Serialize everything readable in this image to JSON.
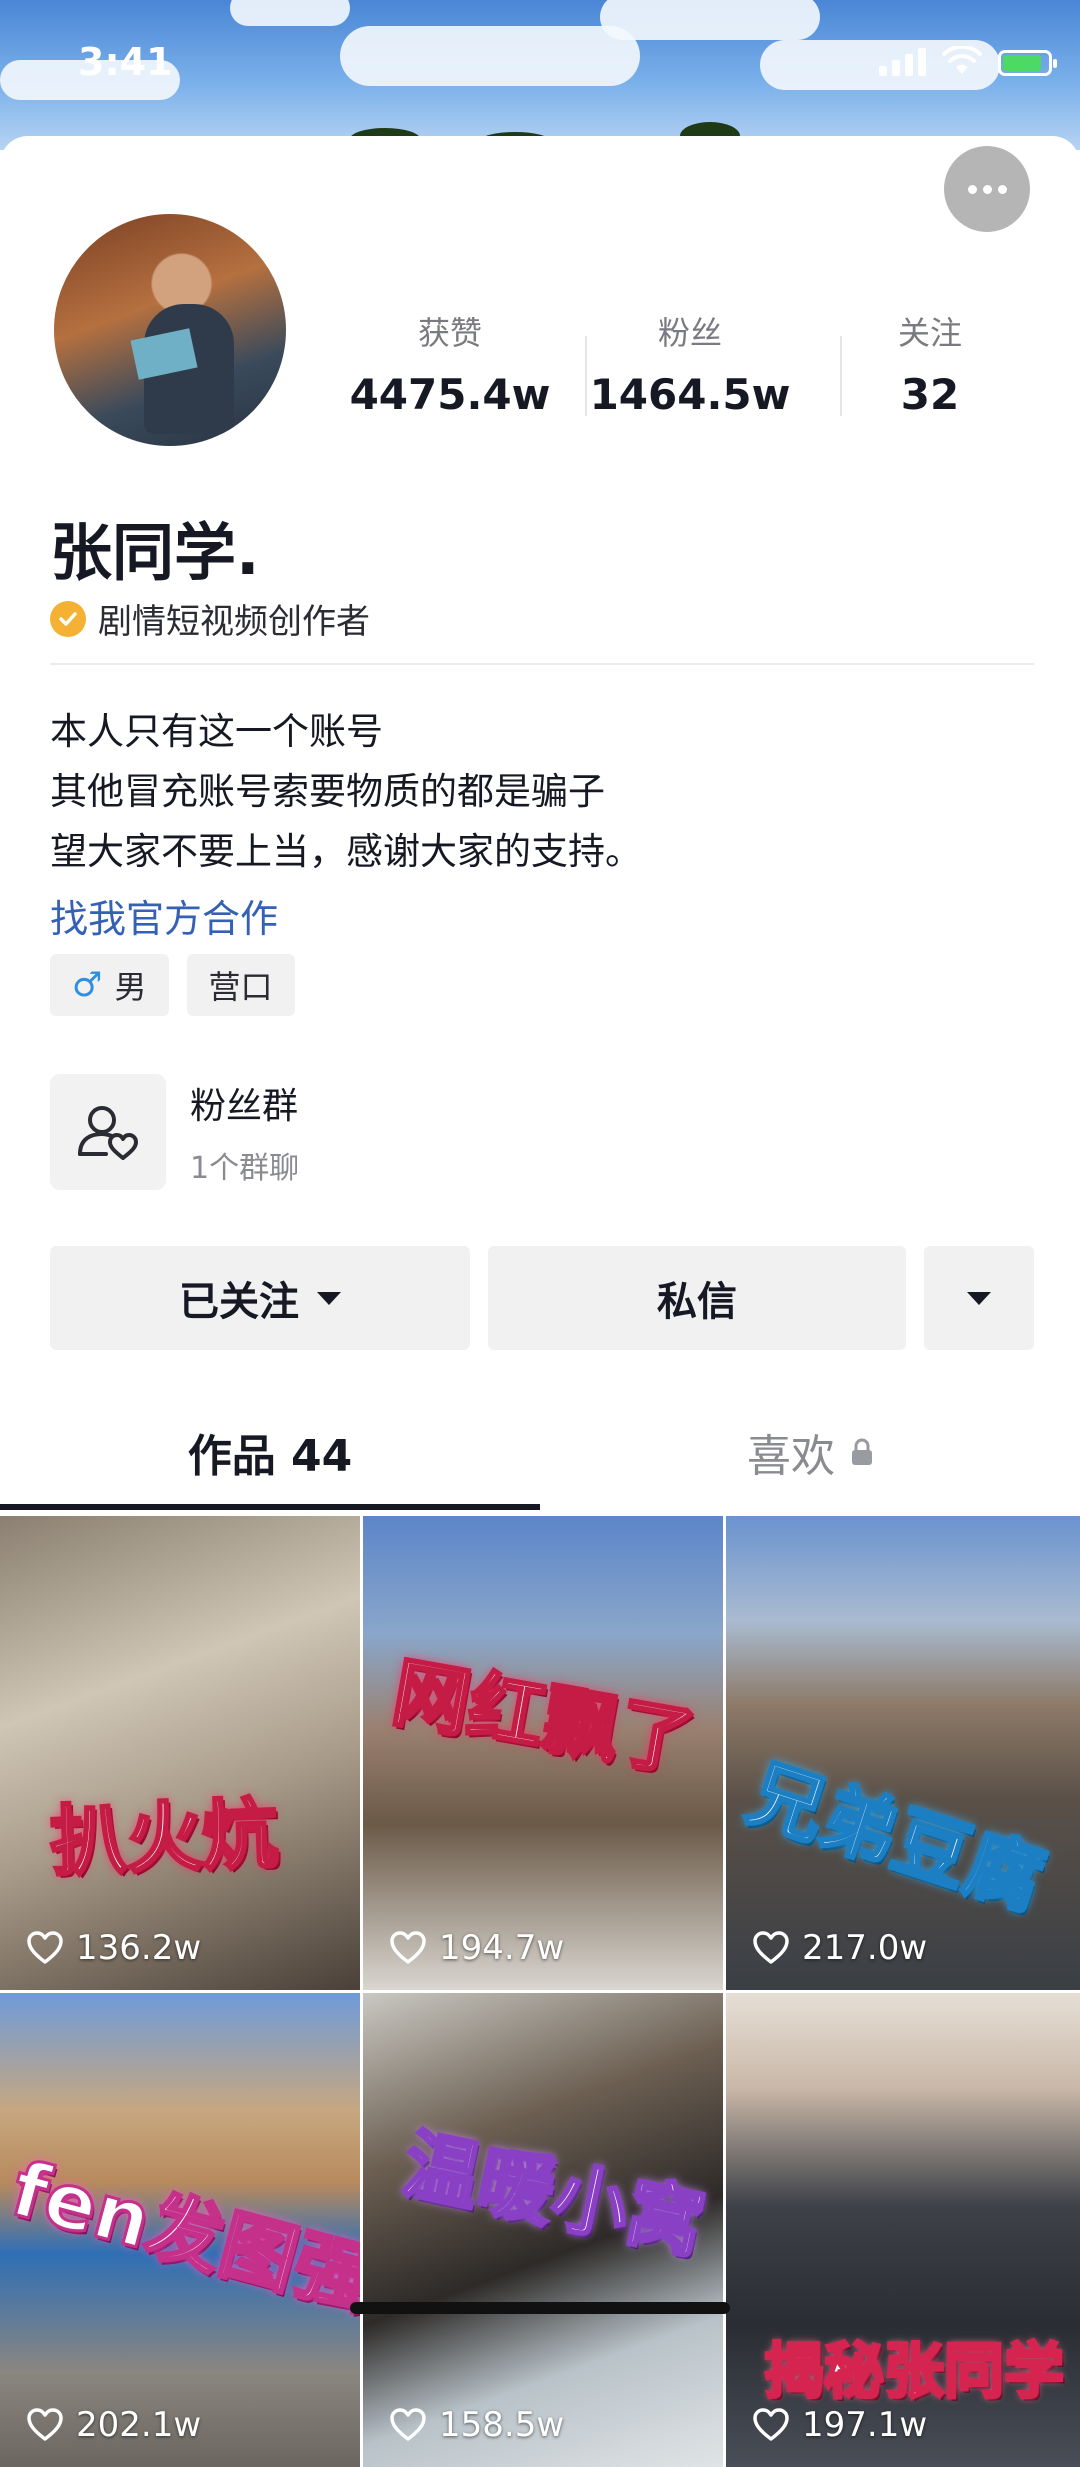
{
  "status_bar": {
    "time": "3:41"
  },
  "profile": {
    "stats": [
      {
        "label": "获赞",
        "value": "4475.4w"
      },
      {
        "label": "粉丝",
        "value": "1464.5w"
      },
      {
        "label": "关注",
        "value": "32"
      }
    ],
    "name": "张同学.",
    "verification": "剧情短视频创作者",
    "bio": [
      "本人只有这一个账号",
      "其他冒充账号索要物质的都是骗子",
      "望大家不要上当，感谢大家的支持。"
    ],
    "link_text": "找我官方合作",
    "tags": [
      {
        "icon": "male-icon",
        "text": "男"
      },
      {
        "text": "营口"
      }
    ]
  },
  "fans_group": {
    "title": "粉丝群",
    "subtitle": "1个群聊"
  },
  "actions": {
    "followed": "已关注",
    "message": "私信"
  },
  "tabs": {
    "works": "作品 44",
    "likes": "喜欢"
  },
  "videos": [
    {
      "title": "扒火炕",
      "likes": "136.2w"
    },
    {
      "title": "网红飘了",
      "likes": "194.7w"
    },
    {
      "title": "兄弟豆腐",
      "likes": "217.0w"
    },
    {
      "title": "fen发图强",
      "likes": "202.1w"
    },
    {
      "title": "温暖小窝",
      "likes": "158.5w"
    },
    {
      "title": "揭秘张同学",
      "likes": "197.1w"
    }
  ]
}
